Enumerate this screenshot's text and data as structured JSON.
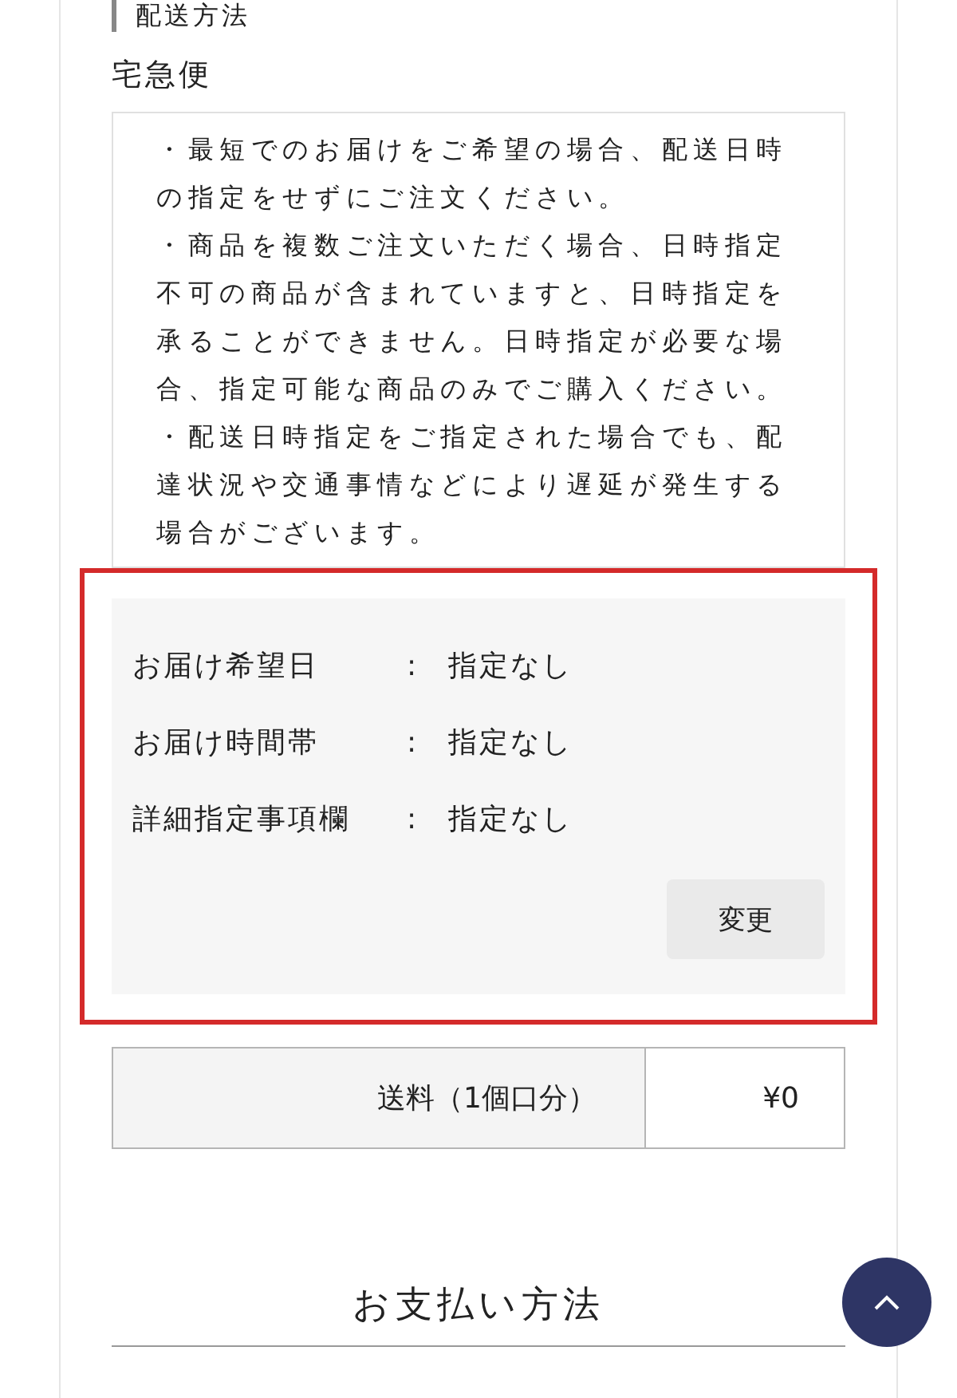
{
  "section_heading": "配送方法",
  "shipping_method": "宅急便",
  "notes": [
    "・最短でのお届けをご希望の場合、配送日時の指定をせずにご注文ください。",
    "・商品を複数ご注文いただく場合、日時指定不可の商品が含まれていますと、日時指定を承ることができません。日時指定が必要な場合、指定可能な商品のみでご購入ください。",
    "・配送日時指定をご指定された場合でも、配達状況や交通事情などにより遅延が発生する場合がございます。"
  ],
  "delivery_options": [
    {
      "label": "お届け希望日",
      "separator": ":",
      "value": "指定なし"
    },
    {
      "label": "お届け時間帯",
      "separator": ":",
      "value": "指定なし"
    },
    {
      "label": "詳細指定事項欄",
      "separator": ":",
      "value": "指定なし"
    }
  ],
  "change_button": "変更",
  "shipping_fee": {
    "label": "送料（1個口分）",
    "value": "¥0"
  },
  "next_section_heading": "お支払い方法"
}
